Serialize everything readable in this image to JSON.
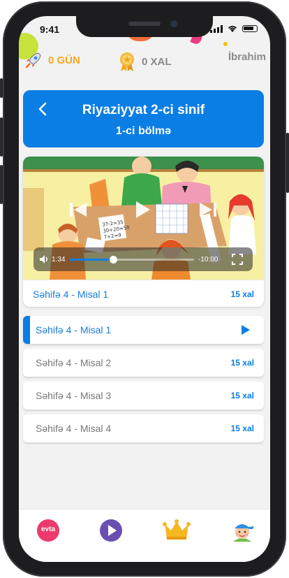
{
  "status_bar": {
    "time": "9:41"
  },
  "stats": {
    "days_label": "0 GÜN",
    "points_label": "0 XAL",
    "user_name": "İbrahim"
  },
  "header": {
    "title": "Riyaziyyat 2-ci sinif",
    "subtitle": "1-ci bölmə"
  },
  "video": {
    "current_time": "1:34",
    "remaining_time": "-10:00",
    "progress": 0.35,
    "caption": "Səhifə 4 - Misal 1",
    "points": "15 xal"
  },
  "lessons": [
    {
      "label": "Səhifə 4 - Misal 1",
      "points": "",
      "active": true
    },
    {
      "label": "Səhifə 4 - Misal 2",
      "points": "15 xal",
      "active": false
    },
    {
      "label": "Səhifə 4 - Misal 3",
      "points": "15 xal",
      "active": false
    },
    {
      "label": "Səhifə 4 - Misal 4",
      "points": "15 xal",
      "active": false
    }
  ],
  "bottom_nav": {
    "logo_text": "evta",
    "items": [
      "evta-logo-icon",
      "play-icon",
      "crown-icon",
      "avatar-icon"
    ]
  },
  "colors": {
    "primary": "#0a7ee5",
    "gold": "#f4a91e",
    "play_purple": "#6a4fb3",
    "logo_pink": "#ec3a6d"
  }
}
